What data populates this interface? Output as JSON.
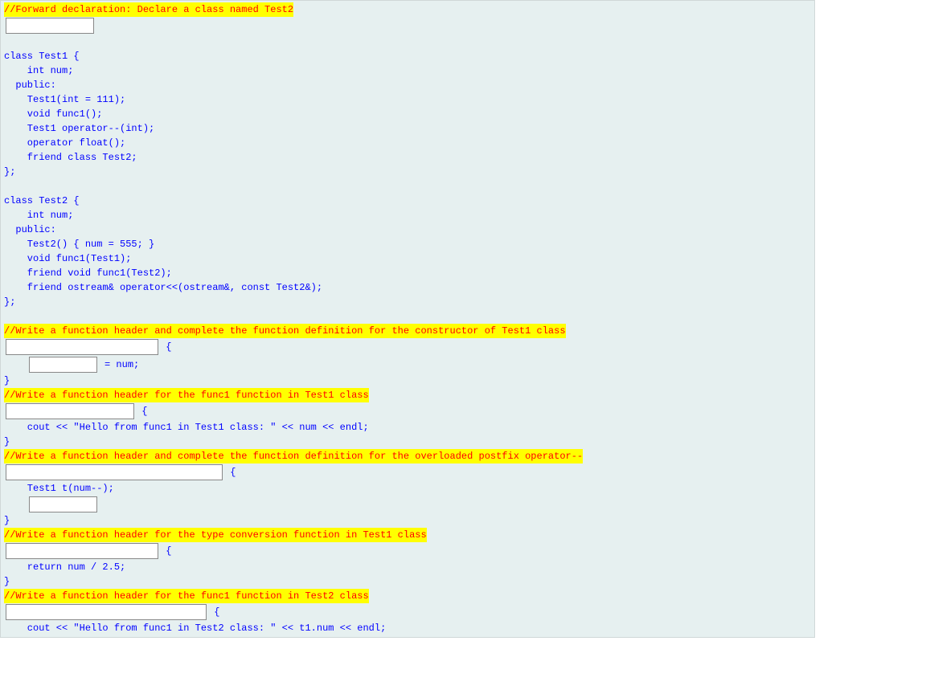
{
  "c1": "//Forward declaration: Declare a class named Test2",
  "l1": "class Test1 {",
  "l2": "    int num;",
  "l3": "  public:",
  "l4": "    Test1(int = 111);",
  "l5": "    void func1();",
  "l6": "    Test1 operator--(int);",
  "l7": "    operator float();",
  "l8": "    friend class Test2;",
  "l9": "};",
  "l10": "class Test2 {",
  "l11": "    int num;",
  "l12": "  public:",
  "l13": "    Test2() { num = 555; }",
  "l14": "    void func1(Test1);",
  "l15": "    friend void func1(Test2);",
  "l16": "    friend ostream& operator<<(ostream&, const Test2&);",
  "l17": "};",
  "c2": "//Write a function header and complete the function definition for the constructor of Test1 class",
  "b1_after": " {",
  "b2_after": " = num;",
  "close": "}",
  "c3": "//Write a function header for the func1 function in Test1 class",
  "b3_after": " {",
  "l18": "    cout << \"Hello from func1 in Test1 class: \" << num << endl;",
  "c4": "//Write a function header and complete the function definition for the overloaded postfix operator--",
  "b4_after": " {",
  "l19": "    Test1 t(num--);",
  "c5": "//Write a function header for the type conversion function in Test1 class",
  "b5_after": " {",
  "l20": "    return num / 2.5;",
  "c6": "//Write a function header for the func1 function in Test2 class",
  "b6_after": " {",
  "l21": "    cout << \"Hello from func1 in Test2 class: \" << t1.num << endl;",
  "indent4": "    "
}
